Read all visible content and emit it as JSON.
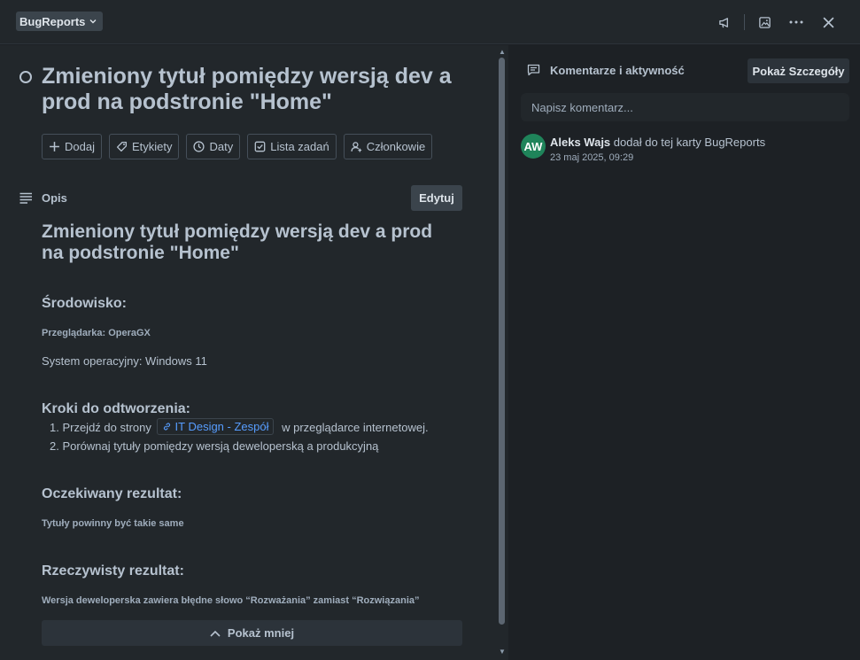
{
  "header": {
    "list_name": "BugReports",
    "icons": [
      "megaphone-icon",
      "image-icon",
      "more-icon",
      "close-icon"
    ]
  },
  "card": {
    "title": "Zmieniony tytuł pomiędzy wersją dev a prod na podstronie \"Home\"",
    "actions": [
      {
        "label": "Dodaj",
        "icon": "plus-icon"
      },
      {
        "label": "Etykiety",
        "icon": "tag-icon"
      },
      {
        "label": "Daty",
        "icon": "clock-icon"
      },
      {
        "label": "Lista zadań",
        "icon": "checkbox-icon"
      },
      {
        "label": "Członkowie",
        "icon": "user-add-icon"
      }
    ]
  },
  "description": {
    "label": "Opis",
    "edit_label": "Edytuj",
    "heading": "Zmieniony tytuł pomiędzy wersją dev a prod na podstronie \"Home\"",
    "env_heading": "Środowisko:",
    "browser": "Przeglądarka: OperaGX",
    "os": "System operacyjny: Windows 11",
    "steps_heading": "Kroki do odtworzenia:",
    "step1_prefix": "1. Przejdź do strony",
    "step1_link": "IT Design - Zespół",
    "step1_suffix": "w przeglądarce internetowej.",
    "step2": "2. Porównaj tytuły pomiędzy wersją deweloperską a produkcyjną",
    "expected_heading": "Oczekiwany rezultat:",
    "expected_text": "Tytuły powinny być takie same",
    "actual_heading": "Rzeczywisty rezultat:",
    "actual_text": "Wersja deweloperska zawiera błędne słowo “Rozważania” zamiast “Rozwiązania”",
    "show_less": "Pokaż mniej"
  },
  "comments": {
    "label": "Komentarze i aktywność",
    "details_label": "Pokaż Szczegóły",
    "placeholder": "Napisz komentarz...",
    "activity": {
      "avatar_initials": "AW",
      "avatar_color": "#1f845a",
      "user": "Aleks Wajs",
      "text": "dodał do tej karty BugReports",
      "time": "23 maj 2025, 09:29"
    }
  }
}
